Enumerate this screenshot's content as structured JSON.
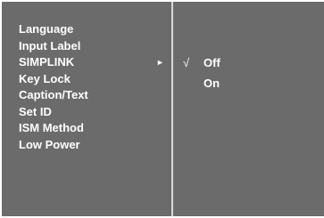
{
  "menu": {
    "items": [
      {
        "label": "Language"
      },
      {
        "label": "Input Label"
      },
      {
        "label": "SIMPLINK",
        "arrow": "►"
      },
      {
        "label": "Key Lock"
      },
      {
        "label": "Caption/Text"
      },
      {
        "label": "Set ID"
      },
      {
        "label": "ISM Method"
      },
      {
        "label": "Low Power"
      }
    ]
  },
  "submenu": {
    "options": [
      {
        "label": "Off",
        "check": "√",
        "selected": true
      },
      {
        "label": "On",
        "check": "",
        "selected": false
      }
    ]
  },
  "colors": {
    "panel_bg": "#6b6b6b",
    "divider": "#d9d9d9",
    "text": "#ffffff"
  }
}
